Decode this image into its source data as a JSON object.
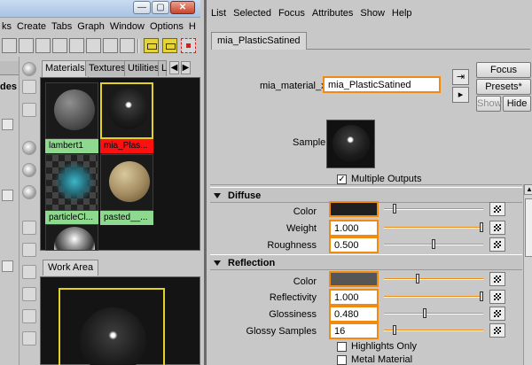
{
  "hypershade": {
    "menubar": [
      "ks",
      "Create",
      "Tabs",
      "Graph",
      "Window",
      "Options",
      "H"
    ],
    "window_controls": {
      "minimize": "—",
      "maximize": "▢",
      "close": "✕"
    },
    "left_label": "des",
    "tabs": [
      {
        "label": "Materials",
        "active": true
      },
      {
        "label": "Textures",
        "active": false
      },
      {
        "label": "Utilities",
        "active": false
      },
      {
        "label": "L",
        "active": false
      }
    ],
    "tab_arrows": {
      "left": "◀",
      "right": "▶"
    },
    "materials": [
      {
        "name": "lambert1",
        "selected": false,
        "icon": "grey-sphere"
      },
      {
        "name": "mia_Plas...",
        "selected": true,
        "icon": "dark-glossy-sphere"
      },
      {
        "name": "particleCl...",
        "selected": false,
        "icon": "checker-teal-sphere"
      },
      {
        "name": "pasted__...",
        "selected": false,
        "icon": "stone-sphere"
      }
    ],
    "work_area_tab": "Work Area"
  },
  "attribute_editor": {
    "menubar": [
      "List",
      "Selected",
      "Focus",
      "Attributes",
      "Show",
      "Help"
    ],
    "node_tab": "mia_PlasticSatined",
    "name_label": "mia_material_x:",
    "name_value": "mia_PlasticSatined",
    "buttons": {
      "focus": "Focus",
      "presets": "Presets*",
      "show": "Show",
      "hide": "Hide"
    },
    "sample_label": "Sample",
    "multiple_outputs": {
      "label": "Multiple Outputs",
      "checked": true,
      "mark": "✓"
    },
    "diffuse": {
      "title": "Diffuse",
      "color_label": "Color",
      "color_value": "#1f1f1f",
      "weight_label": "Weight",
      "weight_value": "1.000",
      "roughness_label": "Roughness",
      "roughness_value": "0.500"
    },
    "reflection": {
      "title": "Reflection",
      "color_label": "Color",
      "color_value": "#565656",
      "reflectivity_label": "Reflectivity",
      "reflectivity_value": "1.000",
      "glossiness_label": "Glossiness",
      "glossiness_value": "0.480",
      "glossy_samples_label": "Glossy Samples",
      "glossy_samples_value": "16",
      "highlights_only_label": "Highlights Only",
      "metal_material_label": "Metal Material"
    }
  },
  "colors": {
    "accent": "#f08a10",
    "selected_label": "#ff1010",
    "material_label": "#8fd88f",
    "selection_frame": "#e1d320"
  }
}
